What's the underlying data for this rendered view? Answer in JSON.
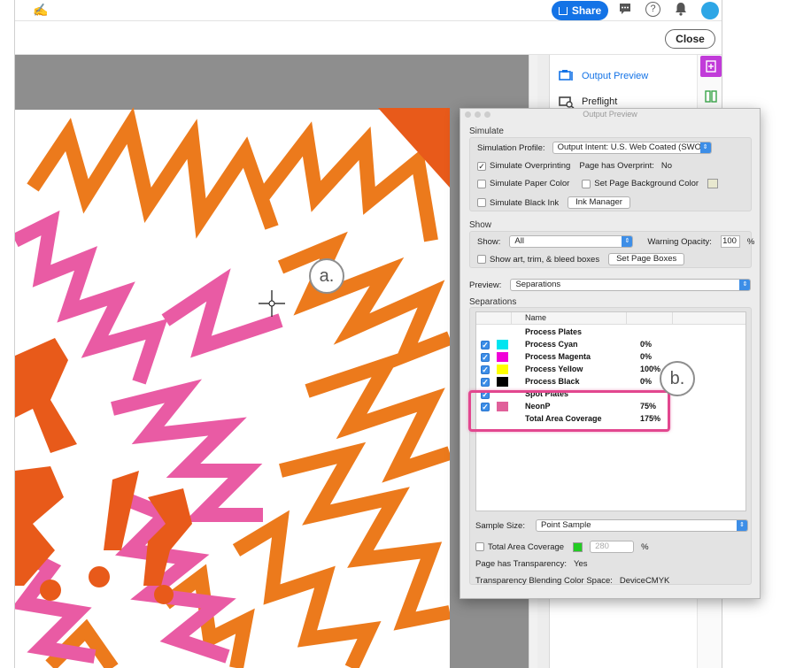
{
  "app": {
    "share_label": "Share",
    "close_label": "Close",
    "help_glyph": "?"
  },
  "icons": {
    "sign": "fill-sign-icon",
    "comment": "comment-icon",
    "help": "help-icon",
    "bell": "bell-icon",
    "share": "share-icon"
  },
  "right_pane": {
    "items": [
      {
        "label": "Output Preview",
        "icon": "output-preview-icon"
      },
      {
        "label": "Preflight",
        "icon": "preflight-icon"
      }
    ]
  },
  "callouts": {
    "a": "a.",
    "b": "b."
  },
  "dialog": {
    "title": "Output Preview",
    "simulate": {
      "heading": "Simulate",
      "profile_label": "Simulation Profile:",
      "profile_value": "Output Intent: U.S. Web Coated (SWOP)...",
      "overprint_label": "Simulate Overprinting",
      "overprint_checked": true,
      "has_overprint_label": "Page has Overprint:",
      "has_overprint_value": "No",
      "paper_color_label": "Simulate Paper Color",
      "bg_color_label": "Set Page Background Color",
      "black_ink_label": "Simulate Black Ink",
      "ink_manager_label": "Ink Manager"
    },
    "show": {
      "heading": "Show",
      "show_label": "Show:",
      "show_value": "All",
      "warning_label": "Warning Opacity:",
      "warning_value": "100",
      "percent": "%",
      "boxes_label": "Show art, trim, & bleed boxes",
      "page_boxes_label": "Set Page Boxes"
    },
    "preview_label": "Preview:",
    "preview_value": "Separations",
    "separations_heading": "Separations",
    "table": {
      "name_header": "Name",
      "rows": [
        {
          "checked": false,
          "color": "",
          "name": "Process Plates",
          "pct": ""
        },
        {
          "checked": true,
          "color": "#00e5f0",
          "name": "Process Cyan",
          "pct": "0%"
        },
        {
          "checked": true,
          "color": "#f000d8",
          "name": "Process Magenta",
          "pct": "0%"
        },
        {
          "checked": true,
          "color": "#ffff00",
          "name": "Process Yellow",
          "pct": "100%"
        },
        {
          "checked": true,
          "color": "#000000",
          "name": "Process Black",
          "pct": "0%"
        },
        {
          "checked": true,
          "color": "",
          "name": "Spot Plates",
          "pct": ""
        },
        {
          "checked": true,
          "color": "#e0609a",
          "name": "NeonP",
          "pct": "75%"
        },
        {
          "checked": false,
          "color": "",
          "name": "Total Area Coverage",
          "pct": "175%"
        }
      ]
    },
    "sample_size_label": "Sample Size:",
    "sample_size_value": "Point Sample",
    "tac_label": "Total Area Coverage",
    "tac_value": "280",
    "tac_percent": "%",
    "transparency_label": "Page has Transparency:",
    "transparency_value": "Yes",
    "blend_label": "Transparency Blending Color Space:",
    "blend_value": "DeviceCMYK"
  },
  "colors": {
    "orange": "#ec7a1c",
    "dark_orange": "#e85a1a",
    "pink": "#e95ba4",
    "highlight": "#e2478f",
    "accent": "#1473e6"
  }
}
